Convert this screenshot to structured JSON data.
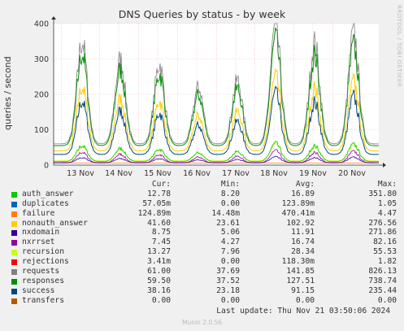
{
  "chart_data": {
    "type": "line",
    "title": "DNS Queries by status - by week",
    "ylabel": "queries / second",
    "ylim": [
      0,
      400
    ],
    "yticks": [
      0,
      100,
      200,
      300,
      400
    ],
    "xtick_labels": [
      "13 Nov",
      "14 Nov",
      "15 Nov",
      "16 Nov",
      "17 Nov",
      "18 Nov",
      "19 Nov",
      "20 Nov"
    ],
    "grid": true,
    "side_label": "RRDTOOL / TOBI OETIKER",
    "series": [
      {
        "name": "auth_answer",
        "color": "#00cc00",
        "cur": "12.78",
        "min": "8.20",
        "avg": "16.89",
        "max": "351.80"
      },
      {
        "name": "duplicates",
        "color": "#0066b3",
        "cur": "57.05m",
        "min": "0.00",
        "avg": "123.89m",
        "max": "1.05"
      },
      {
        "name": "failure",
        "color": "#ff8000",
        "cur": "124.89m",
        "min": "14.48m",
        "avg": "470.41m",
        "max": "4.47"
      },
      {
        "name": "nonauth_answer",
        "color": "#ffcc00",
        "cur": "41.60",
        "min": "23.61",
        "avg": "102.92",
        "max": "276.56"
      },
      {
        "name": "nxdomain",
        "color": "#330099",
        "cur": "8.75",
        "min": "5.06",
        "avg": "11.91",
        "max": "271.86"
      },
      {
        "name": "nxrrset",
        "color": "#990099",
        "cur": "7.45",
        "min": "4.27",
        "avg": "16.74",
        "max": "82.16"
      },
      {
        "name": "recursion",
        "color": "#ccff00",
        "cur": "13.27",
        "min": "7.96",
        "avg": "28.34",
        "max": "55.53"
      },
      {
        "name": "rejections",
        "color": "#ff0000",
        "cur": "3.41m",
        "min": "0.00",
        "avg": "118.30m",
        "max": "1.82"
      },
      {
        "name": "requests",
        "color": "#808080",
        "cur": "61.00",
        "min": "37.69",
        "avg": "141.85",
        "max": "826.13"
      },
      {
        "name": "responses",
        "color": "#008f00",
        "cur": "59.50",
        "min": "37.52",
        "avg": "127.51",
        "max": "738.74"
      },
      {
        "name": "success",
        "color": "#00487d",
        "cur": "38.16",
        "min": "23.18",
        "avg": "91.15",
        "max": "235.44"
      },
      {
        "name": "transfers",
        "color": "#b35a00",
        "cur": "0.00",
        "min": "0.00",
        "avg": "0.00",
        "max": "0.00"
      }
    ]
  },
  "legend_headers": {
    "cur": "Cur:",
    "min": "Min:",
    "avg": "Avg:",
    "max": "Max:"
  },
  "last_update": "Last update: Thu Nov 21 03:50:06 2024",
  "footer": "Munin 2.0.56"
}
